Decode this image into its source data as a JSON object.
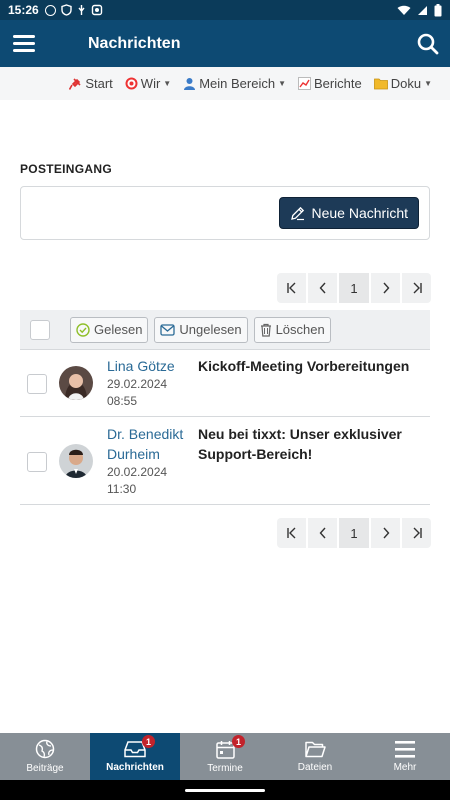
{
  "status_bar": {
    "time": "15:26"
  },
  "app_bar": {
    "title": "Nachrichten"
  },
  "top_nav": {
    "items": [
      {
        "icon": "pin-icon",
        "label": "Start",
        "has_dropdown": false
      },
      {
        "icon": "target-icon",
        "label": "Wir",
        "has_dropdown": true
      },
      {
        "icon": "user-icon",
        "label": "Mein Bereich",
        "has_dropdown": true
      },
      {
        "icon": "chart-icon",
        "label": "Berichte",
        "has_dropdown": false
      },
      {
        "icon": "folder-icon",
        "label": "Doku",
        "has_dropdown": true
      }
    ]
  },
  "inbox": {
    "title": "POSTEINGANG",
    "new_message_label": "Neue Nachricht",
    "current_page": "1",
    "toolbar": {
      "read_label": "Gelesen",
      "unread_label": "Ungelesen",
      "delete_label": "Löschen"
    },
    "messages": [
      {
        "sender": "Lina Götze",
        "date": "29.02.2024",
        "time": "08:55",
        "subject": "Kickoff-Meeting Vorbereitungen"
      },
      {
        "sender": "Dr. Benedikt Durheim",
        "date": "20.02.2024",
        "time": "11:30",
        "subject": "Neu bei tixxt: Unser exklusiver Support-Bereich!"
      }
    ]
  },
  "tab_bar": {
    "tabs": [
      {
        "label": "Beiträge",
        "icon": "globe-icon",
        "badge": ""
      },
      {
        "label": "Nachrichten",
        "icon": "inbox-icon",
        "badge": "1",
        "active": true
      },
      {
        "label": "Termine",
        "icon": "calendar-icon",
        "badge": "1"
      },
      {
        "label": "Dateien",
        "icon": "folder-icon",
        "badge": ""
      },
      {
        "label": "Mehr",
        "icon": "menu-icon",
        "badge": ""
      }
    ]
  },
  "colors": {
    "header": "#0d4a73",
    "button": "#1d3a57",
    "link": "#2a6a96",
    "badge": "#c2232b",
    "tabbar": "#878f96"
  }
}
